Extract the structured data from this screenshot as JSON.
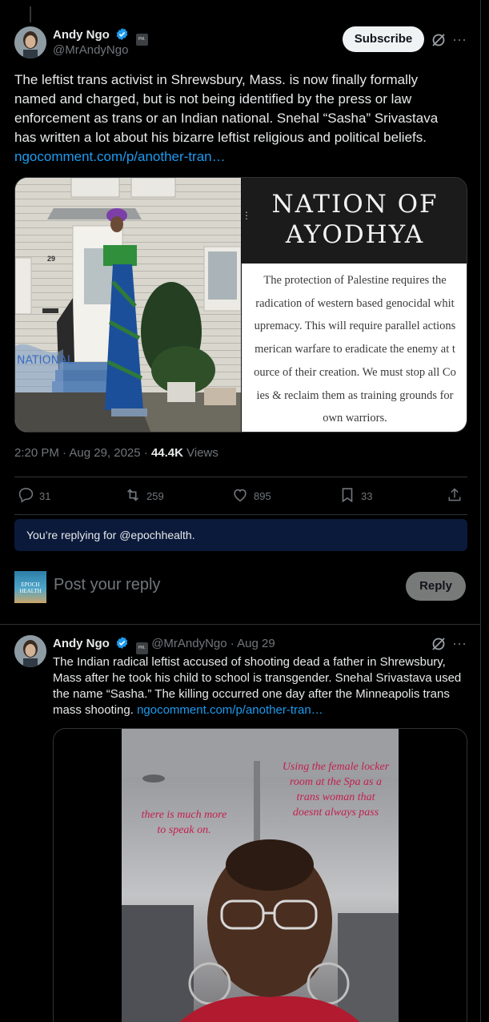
{
  "post": {
    "author_name": "Andy Ngo",
    "author_handle": "@MrAndyNgo",
    "affiliate_badge": "PM.",
    "subscribe_label": "Subscribe",
    "text": "The leftist trans activist in Shrewsbury, Mass. is now finally formally named and charged, but is not being identified by the press or law enforcement as trans or an Indian national. Snehal “Sasha” Srivastava has written a lot about his bizarre leftist religious and political beliefs. ",
    "link": "ngocomment.com/p/another-tran…",
    "media": {
      "house_number": "29",
      "graffiti": "NATIONAL",
      "nation_title_line1": "NATION OF",
      "nation_title_line2": "AYODHYA",
      "nation_lines": [
        "The protection of Palestine requires the",
        "radication of western based genocidal whit",
        "upremacy. This will require parallel actions",
        "merican warfare to eradicate the enemy at t",
        "ource of their creation. We must stop all Co",
        "ies & reclaim them as training grounds for",
        "own warriors."
      ]
    },
    "time": "2:20 PM · Aug 29, 2025 · ",
    "views_count": "44.4K",
    "views_label": " Views",
    "stats": {
      "replies": "31",
      "reposts": "259",
      "likes": "895",
      "bookmarks": "33"
    }
  },
  "reply_banner": "You’re replying for @epochhealth.",
  "compose": {
    "avatar_line1": "EPOCH",
    "avatar_line2": "HEALTH",
    "placeholder": "Post your reply",
    "reply_button": "Reply"
  },
  "post2": {
    "author_name": "Andy Ngo",
    "author_handle": "@MrAndyNgo",
    "affiliate_badge": "PM.",
    "date": " · Aug 29",
    "text": "The Indian radical leftist accused of shooting dead a father in Shrewsbury, Mass after he took his child to school is transgender. Snehal Srivastava used the name “Sasha.” The killing occurred one day after the Minneapolis trans mass shooting. ",
    "link": "ngocomment.com/p/another-tran…",
    "video_caption_left": "there is much more to speak on.",
    "video_caption_right": "Using the female locker room at the Spa as a trans woman that doesnt always pass"
  },
  "colors": {
    "background": "#000000",
    "link": "#1d9bf0",
    "verified": "#1d9bf0",
    "banner": "#0b1a3b",
    "caption": "#c41f4d"
  }
}
